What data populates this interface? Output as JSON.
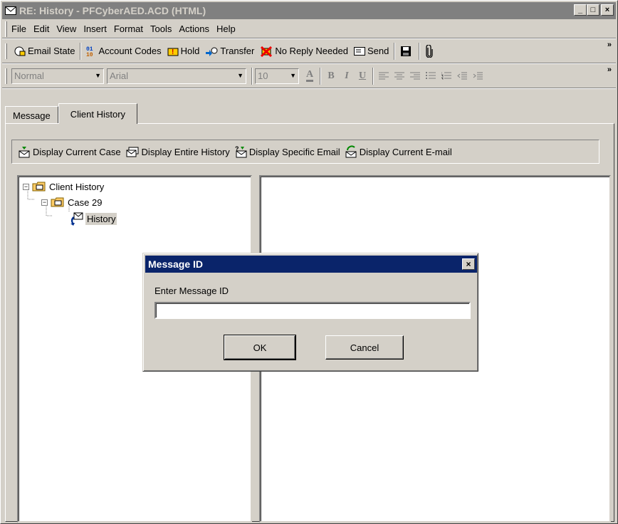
{
  "window": {
    "title": "RE: History - PFCyberAED.ACD (HTML)",
    "min": "_",
    "max": "□",
    "close": "×"
  },
  "menu": [
    "File",
    "Edit",
    "View",
    "Insert",
    "Format",
    "Tools",
    "Actions",
    "Help"
  ],
  "toolbar": {
    "email_state": "Email State",
    "account_codes": "Account Codes",
    "hold": "Hold",
    "transfer": "Transfer",
    "no_reply": "No Reply Needed",
    "send": "Send",
    "more": "»"
  },
  "format_bar": {
    "style": "Normal",
    "font": "Arial",
    "size": "10",
    "more": "»"
  },
  "tabs": [
    "Message",
    "Client History"
  ],
  "history_bar": {
    "current_case": "Display Current Case",
    "entire_history": "Display Entire History",
    "specific_email": "Display Specific Email",
    "current_email": "Display Current E-mail"
  },
  "tree": {
    "root": "Client History",
    "case": "Case 29",
    "leaf": "History",
    "collapse": "−"
  },
  "dialog": {
    "title": "Message ID",
    "label": "Enter Message ID",
    "value": "",
    "ok": "OK",
    "cancel": "Cancel",
    "close": "×"
  },
  "colors": {
    "title_active": "#0a246a",
    "title_inactive": "#808080",
    "face": "#d4d0c8"
  }
}
